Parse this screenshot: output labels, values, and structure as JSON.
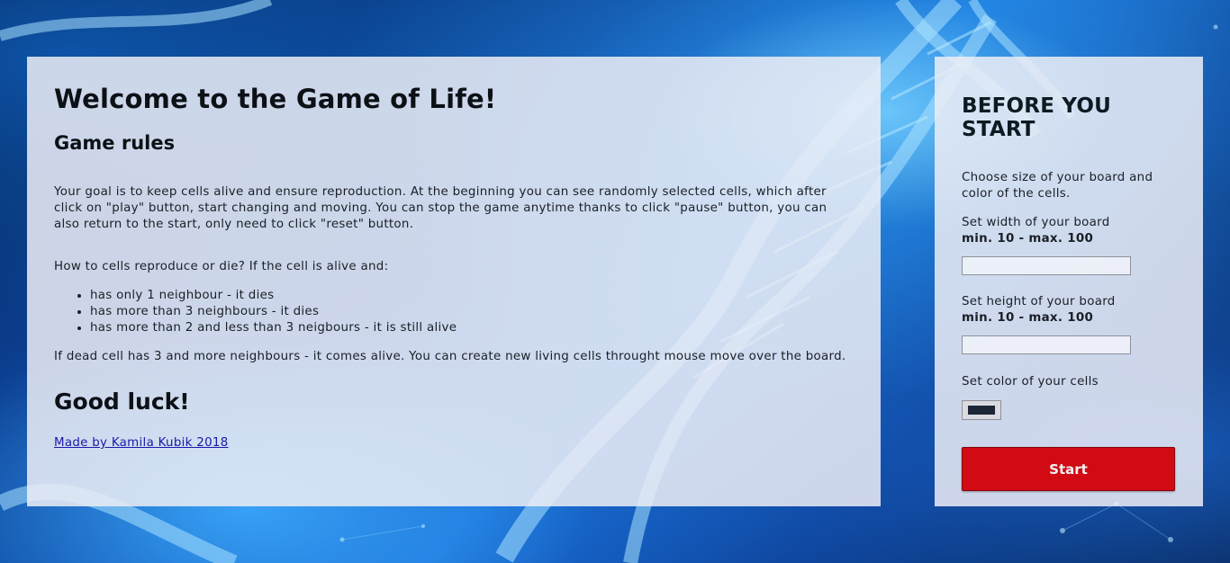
{
  "background": {
    "image": "dna-helix-blue"
  },
  "colors": {
    "start_button": "#d10a14",
    "link": "#1a1aa8",
    "cell_color": "#1b2636"
  },
  "main": {
    "title": "Welcome to the Game of Life!",
    "rules_heading": "Game rules",
    "intro": "Your goal is to keep cells alive and ensure reproduction. At the beginning you can see randomly selected cells, which after click on \"play\" button, start changing and moving. You can stop the game anytime thanks to click \"pause\" button, you can also return to the start, only need to click \"reset\" button.",
    "question": "How to cells reproduce or die? If the cell is alive and:",
    "rules": [
      "has only 1 neighbour - it dies",
      "has more than 3 neighbours - it dies",
      "has more than 2 and less than 3 neigbours - it is still alive"
    ],
    "dead_cell": "If dead cell has 3 and more neighbours - it comes alive. You can create new living cells throught mouse move over the board.",
    "good_luck": "Good luck!",
    "credit": "Made by Kamila Kubik 2018"
  },
  "sidebar": {
    "title": "BEFORE YOU START",
    "choose_text": "Choose size of your board and color of the cells.",
    "width_label": "Set width of your board",
    "width_limit": "min. 10 - max. 100",
    "width_value": "",
    "height_label": "Set height of your board",
    "height_limit": "min. 10 - max. 100",
    "height_value": "",
    "color_label": "Set color of your cells",
    "start_label": "Start"
  }
}
